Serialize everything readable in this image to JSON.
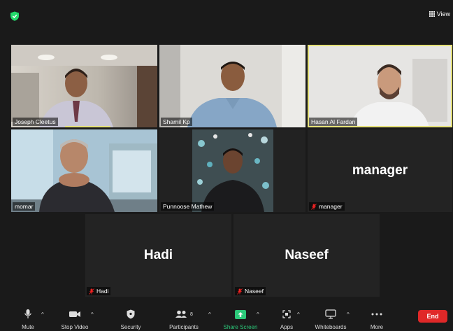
{
  "topbar": {
    "view_label": "View",
    "security_color": "#23d96b"
  },
  "participants": [
    {
      "name": "Joseph Cleetus",
      "video": true
    },
    {
      "name": "Shamil Kp",
      "video": true
    },
    {
      "name": "Hasan Al Fardan",
      "video": true,
      "active_speaker": true
    },
    {
      "name": "momar",
      "video": true
    },
    {
      "name": "Punnoose Mathew",
      "video": true
    },
    {
      "name": "manager",
      "video": false,
      "display_name": "manager",
      "muted": true
    },
    {
      "name": "Hadi",
      "video": false,
      "display_name": "Hadi",
      "muted": true
    },
    {
      "name": "Naseef",
      "video": false,
      "display_name": "Naseef",
      "muted": true
    }
  ],
  "toolbar": {
    "mute": "Mute",
    "stop_video": "Stop Video",
    "security": "Security",
    "participants": "Participants",
    "participants_count": "8",
    "share_screen": "Share Screen",
    "apps": "Apps",
    "whiteboards": "Whiteboards",
    "more": "More",
    "end": "End",
    "caret": "^"
  },
  "colors": {
    "active_border": "#e6e27a",
    "end_red": "#e02828",
    "share_green": "#2cc97a"
  }
}
